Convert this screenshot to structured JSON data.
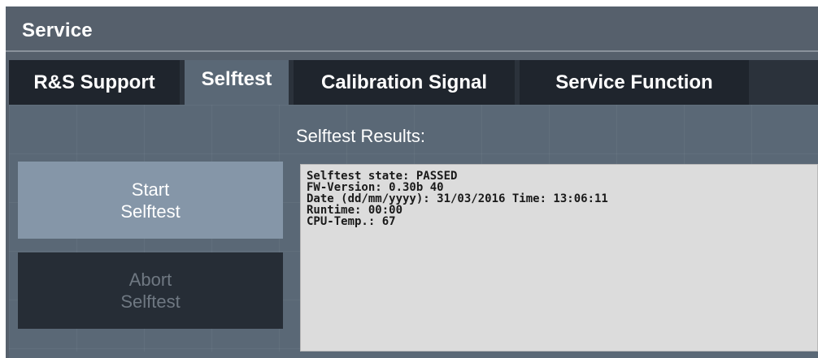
{
  "window": {
    "title": "Service"
  },
  "tabs": [
    {
      "label": "R&S Support",
      "active": false
    },
    {
      "label": "Selftest",
      "active": true
    },
    {
      "label": "Calibration Signal",
      "active": false
    },
    {
      "label": "Service Function",
      "active": false
    }
  ],
  "selftest": {
    "results_label": "Selftest Results:",
    "start_button": {
      "line1": "Start",
      "line2": "Selftest"
    },
    "abort_button": {
      "line1": "Abort",
      "line2": "Selftest",
      "enabled": false
    },
    "results": [
      "Selftest state: PASSED",
      "FW-Version: 0.30b 40",
      "Date (dd/mm/yyyy): 31/03/2016 Time: 13:06:11",
      "Runtime: 00:00",
      "CPU-Temp.: 67"
    ]
  },
  "colors": {
    "title_bar": "#56606c",
    "tab_inactive": "#1f252d",
    "tab_active": "#5a6876",
    "content_bg": "#5a6876",
    "start_button": "#8596a8",
    "abort_button": "#262d36",
    "results_bg": "#dcdcdc"
  }
}
